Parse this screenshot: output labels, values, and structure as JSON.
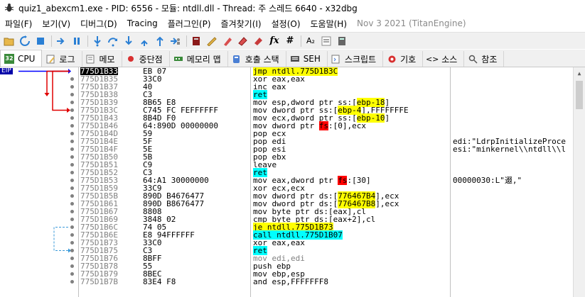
{
  "window": {
    "title": "quiz1_abexcm1.exe - PID: 6556 - 모듈: ntdll.dll - Thread: 주 스레드 6640 - x32dbg"
  },
  "menu": [
    {
      "label": "파일(F)"
    },
    {
      "label": "보기(V)"
    },
    {
      "label": "디버그(D)"
    },
    {
      "label": "Tracing"
    },
    {
      "label": "플러그인(P)"
    },
    {
      "label": "즐겨찾기(I)"
    },
    {
      "label": "설정(O)"
    },
    {
      "label": "도움말(H)"
    },
    {
      "label": "Nov 3 2021 (TitanEngine)"
    }
  ],
  "toolbar_text": {
    "fx": "fx",
    "hash": "#",
    "az": "A₂"
  },
  "tabs": [
    {
      "label": "CPU",
      "icon": "cpu-chip-icon",
      "badge": "32"
    },
    {
      "label": "로그",
      "icon": "log-icon"
    },
    {
      "label": "메모",
      "icon": "notes-icon"
    },
    {
      "label": "중단점",
      "icon": "breakpoint-icon"
    },
    {
      "label": "메모리 맵",
      "icon": "memory-map-icon"
    },
    {
      "label": "호출 스택",
      "icon": "call-stack-icon"
    },
    {
      "label": "SEH",
      "icon": "seh-icon"
    },
    {
      "label": "스크립트",
      "icon": "script-icon"
    },
    {
      "label": "기호",
      "icon": "symbols-icon"
    },
    {
      "label": "소스",
      "icon": "source-icon",
      "prefix": "<>"
    },
    {
      "label": "참조",
      "icon": "references-icon"
    }
  ],
  "eip_label": "EIP",
  "colors": {
    "highlight_yellow": "#ffff00",
    "highlight_cyan": "#00ffff",
    "jump_red": "#e00000",
    "eip_blue": "#0000a8"
  },
  "disasm": [
    {
      "addr": "775D1B33",
      "bytes": "EB 07",
      "instr": [
        {
          "t": "jmp ntdll.775D1B3C",
          "c": "black",
          "h": "y"
        }
      ],
      "cmt": "",
      "current": true
    },
    {
      "addr": "775D1B35",
      "bytes": "33C0",
      "instr": [
        {
          "t": "xor eax,eax",
          "c": "black"
        }
      ],
      "cmt": ""
    },
    {
      "addr": "775D1B37",
      "bytes": "40",
      "instr": [
        {
          "t": "inc eax",
          "c": "black"
        }
      ],
      "cmt": ""
    },
    {
      "addr": "775D1B38",
      "bytes": "C3",
      "instr": [
        {
          "t": "ret",
          "c": "black",
          "h": "c"
        }
      ],
      "cmt": ""
    },
    {
      "addr": "775D1B39",
      "bytes": "8B65 E8",
      "instr": [
        {
          "t": "mov esp,dword ptr ss:[",
          "c": "black"
        },
        {
          "t": "ebp-18",
          "c": "black",
          "h": "y"
        },
        {
          "t": "]",
          "c": "black"
        }
      ],
      "cmt": ""
    },
    {
      "addr": "775D1B3C",
      "bytes": "C745 FC FEFFFFFF",
      "instr": [
        {
          "t": "mov dword ptr ss:[",
          "c": "black"
        },
        {
          "t": "ebp-4",
          "c": "black",
          "h": "y"
        },
        {
          "t": "],FFFFFFFE",
          "c": "black"
        }
      ],
      "cmt": ""
    },
    {
      "addr": "775D1B43",
      "bytes": "8B4D F0",
      "instr": [
        {
          "t": "mov ecx,dword ptr ss:[",
          "c": "black"
        },
        {
          "t": "ebp-10",
          "c": "black",
          "h": "y"
        },
        {
          "t": "]",
          "c": "black"
        }
      ],
      "cmt": ""
    },
    {
      "addr": "775D1B46",
      "bytes": "64:890D 00000000",
      "instr": [
        {
          "t": "mov dword ptr ",
          "c": "black"
        },
        {
          "t": "fs",
          "c": "black",
          "h": "r"
        },
        {
          "t": ":[0],ecx",
          "c": "black"
        }
      ],
      "cmt": ""
    },
    {
      "addr": "775D1B4D",
      "bytes": "59",
      "instr": [
        {
          "t": "pop ecx",
          "c": "black"
        }
      ],
      "cmt": ""
    },
    {
      "addr": "775D1B4E",
      "bytes": "5F",
      "instr": [
        {
          "t": "pop edi",
          "c": "black"
        }
      ],
      "cmt": "edi:\"LdrpInitializeProce"
    },
    {
      "addr": "775D1B4F",
      "bytes": "5E",
      "instr": [
        {
          "t": "pop esi",
          "c": "black"
        }
      ],
      "cmt": "esi:\"minkernel\\\\ntdll\\\\l"
    },
    {
      "addr": "775D1B50",
      "bytes": "5B",
      "instr": [
        {
          "t": "pop ebx",
          "c": "black"
        }
      ],
      "cmt": ""
    },
    {
      "addr": "775D1B51",
      "bytes": "C9",
      "instr": [
        {
          "t": "leave",
          "c": "black"
        }
      ],
      "cmt": ""
    },
    {
      "addr": "775D1B52",
      "bytes": "C3",
      "instr": [
        {
          "t": "ret",
          "c": "black",
          "h": "c"
        }
      ],
      "cmt": ""
    },
    {
      "addr": "775D1B53",
      "bytes": "64:A1 30000000",
      "instr": [
        {
          "t": "mov eax,dword ptr ",
          "c": "black"
        },
        {
          "t": "fs",
          "c": "black",
          "h": "r"
        },
        {
          "t": ":[30]",
          "c": "black"
        }
      ],
      "cmt": "00000030:L\"逫,\""
    },
    {
      "addr": "775D1B59",
      "bytes": "33C9",
      "instr": [
        {
          "t": "xor ecx,ecx",
          "c": "black"
        }
      ],
      "cmt": ""
    },
    {
      "addr": "775D1B5B",
      "bytes": "890D B4676477",
      "instr": [
        {
          "t": "mov dword ptr ds:[",
          "c": "black"
        },
        {
          "t": "776467B4",
          "c": "black",
          "h": "y"
        },
        {
          "t": "],ecx",
          "c": "black"
        }
      ],
      "cmt": ""
    },
    {
      "addr": "775D1B61",
      "bytes": "890D B8676477",
      "instr": [
        {
          "t": "mov dword ptr ds:[",
          "c": "black"
        },
        {
          "t": "776467B8",
          "c": "black",
          "h": "y"
        },
        {
          "t": "],ecx",
          "c": "black"
        }
      ],
      "cmt": ""
    },
    {
      "addr": "775D1B67",
      "bytes": "8808",
      "instr": [
        {
          "t": "mov byte ptr ds:[eax],cl",
          "c": "black"
        }
      ],
      "cmt": ""
    },
    {
      "addr": "775D1B69",
      "bytes": "3848 02",
      "instr": [
        {
          "t": "cmp byte ptr ds:[eax+2],cl",
          "c": "black"
        }
      ],
      "cmt": ""
    },
    {
      "addr": "775D1B6C",
      "bytes": "74 05",
      "instr": [
        {
          "t": "je ntdll.775D1B73",
          "c": "black",
          "h": "y"
        }
      ],
      "cmt": ""
    },
    {
      "addr": "775D1B6E",
      "bytes": "E8 94FFFFFF",
      "instr": [
        {
          "t": "call ntdll.775D1B07",
          "c": "black",
          "h": "c"
        }
      ],
      "cmt": ""
    },
    {
      "addr": "775D1B73",
      "bytes": "33C0",
      "instr": [
        {
          "t": "xor eax,eax",
          "c": "black"
        }
      ],
      "cmt": ""
    },
    {
      "addr": "775D1B75",
      "bytes": "C3",
      "instr": [
        {
          "t": "ret",
          "c": "black",
          "h": "c"
        }
      ],
      "cmt": ""
    },
    {
      "addr": "775D1B76",
      "bytes": "8BFF",
      "instr": [
        {
          "t": "mov edi,edi",
          "c": "gray"
        }
      ],
      "cmt": ""
    },
    {
      "addr": "775D1B78",
      "bytes": "55",
      "instr": [
        {
          "t": "push ebp",
          "c": "black"
        }
      ],
      "cmt": ""
    },
    {
      "addr": "775D1B79",
      "bytes": "8BEC",
      "instr": [
        {
          "t": "mov ebp,esp",
          "c": "black"
        }
      ],
      "cmt": ""
    },
    {
      "addr": "775D1B7B",
      "bytes": "83E4 F8",
      "instr": [
        {
          "t": "and esp,FFFFFFF8",
          "c": "black"
        }
      ],
      "cmt": ""
    }
  ]
}
